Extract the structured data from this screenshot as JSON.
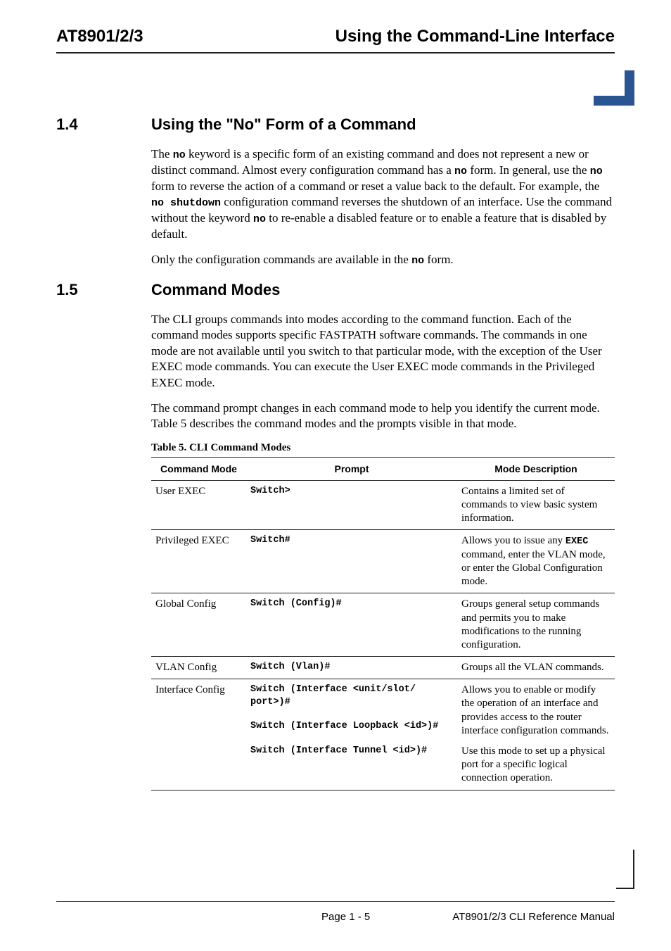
{
  "header": {
    "left": "AT8901/2/3",
    "right": "Using the Command-Line Interface"
  },
  "sections": [
    {
      "num": "1.4",
      "title": "Using the \"No\" Form of a Command",
      "paragraphs": [
        "The |no| keyword is a specific form of an existing command and does not represent a new or distinct command. Almost every configuration command has a |no| form. In general, use the |no| form to reverse the action of a command or reset a value back to the default. For example, the |no shutdown| configuration command reverses the shutdown of an interface. Use the command without the keyword |no| to re-enable a disabled feature or to enable a feature that is disabled by default.",
        "Only the configuration commands are available in the |no| form."
      ]
    },
    {
      "num": "1.5",
      "title": "Command Modes",
      "paragraphs": [
        "The CLI groups commands into modes according to the command function. Each of the command modes supports specific FASTPATH software commands. The commands in one mode are not available until you switch to that particular mode, with the exception of the User EXEC mode commands. You can execute the User EXEC mode commands in the Privileged EXEC mode.",
        "The command prompt changes in each command mode to help you identify the current mode. Table 5 describes the command modes and the prompts visible in that mode."
      ]
    }
  ],
  "table": {
    "caption": "Table 5. CLI Command Modes",
    "headers": [
      "Command Mode",
      "Prompt",
      "Mode Description"
    ],
    "rows": [
      {
        "mode": "User EXEC",
        "prompt": "Switch>",
        "desc": "Contains a limited set of commands to view basic system information."
      },
      {
        "mode": "Privileged EXEC",
        "prompt": "Switch#",
        "desc": "Allows you to issue any |EXEC| command, enter the VLAN mode, or enter the Global Configuration mode."
      },
      {
        "mode": "Global Config",
        "prompt": "Switch (Config)#",
        "desc": "Groups general setup commands and permits you to make modifications to the running configuration."
      },
      {
        "mode": "VLAN Config",
        "prompt": "Switch (Vlan)#",
        "desc": "Groups all the VLAN commands."
      },
      {
        "mode": "Interface Config",
        "prompt": "Switch (Interface <unit/slot/\nport>)#\n\nSwitch (Interface Loopback <id>)#\n\nSwitch (Interface Tunnel <id>)#",
        "desc_multi": [
          "Allows you to enable or modify the operation of an interface and provides access to the router interface configuration commands.",
          "Use this mode to set up a physical port for a specific logical connection operation."
        ]
      }
    ]
  },
  "footer": {
    "page": "Page 1 - 5",
    "doc": "AT8901/2/3 CLI Reference Manual"
  }
}
